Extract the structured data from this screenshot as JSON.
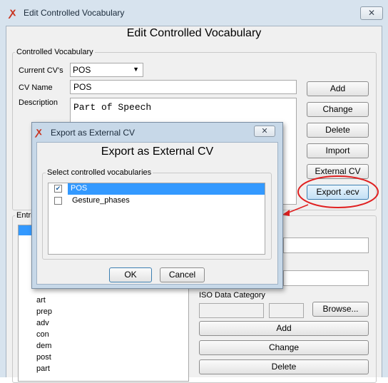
{
  "window": {
    "title": "Edit Controlled Vocabulary",
    "close_glyph": "✕",
    "heading": "Edit Controlled Vocabulary"
  },
  "cv_group": {
    "label": "Controlled Vocabulary",
    "current_label": "Current CV's",
    "current_value": "POS",
    "name_label": "CV Name",
    "name_value": "POS",
    "description_label": "Description",
    "description_value": "Part of Speech",
    "buttons": {
      "add": "Add",
      "change": "Change",
      "delete": "Delete",
      "import": "Import",
      "external": "External CV",
      "export": "Export .ecv"
    }
  },
  "entries_group": {
    "label_visible": "Entri",
    "items": [
      "art",
      "prep",
      "adv",
      "con",
      "dem",
      "post",
      "part"
    ],
    "iso_label": "ISO Data Category",
    "browse": "Browse...",
    "add": "Add",
    "change": "Change",
    "delete": "Delete"
  },
  "dialog": {
    "title": "Export as External CV",
    "heading": "Export as External CV",
    "list_label": "Select controlled vocabularies",
    "items": [
      {
        "label": "POS",
        "checked": true,
        "selected": true
      },
      {
        "label": "Gesture_phases",
        "checked": false,
        "selected": false
      }
    ],
    "ok": "OK",
    "cancel": "Cancel",
    "close_glyph": "✕"
  },
  "colors": {
    "selection": "#3399ff",
    "annotation_red": "#e02020",
    "window_frame": "#d7e3ee"
  },
  "icons": {
    "app": "elan-app-icon",
    "dropdown": "chevron-down-icon"
  }
}
